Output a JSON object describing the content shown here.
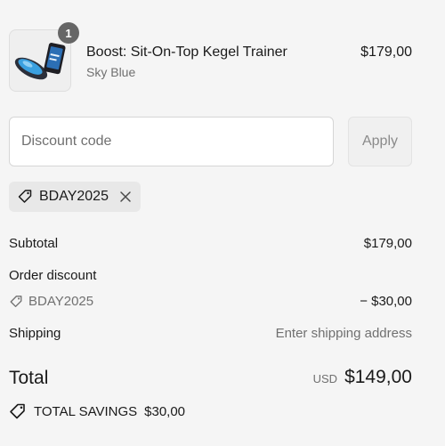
{
  "product": {
    "quantity": "1",
    "name": "Boost: Sit-On-Top Kegel Trainer",
    "variant": "Sky Blue",
    "price": "$179,00",
    "image_icon": "kegel-trainer-with-phone-icon"
  },
  "discount": {
    "placeholder": "Discount code",
    "apply_label": "Apply",
    "applied_code": "BDAY2025"
  },
  "summary": {
    "subtotal_label": "Subtotal",
    "subtotal_value": "$179,00",
    "order_discount_label": "Order discount",
    "discount_code": "BDAY2025",
    "discount_value": "− $30,00",
    "shipping_label": "Shipping",
    "shipping_value": "Enter shipping address",
    "total_label": "Total",
    "currency": "USD",
    "total_value": "$149,00",
    "savings_label": "TOTAL SAVINGS",
    "savings_value": "$30,00"
  },
  "colors": {
    "background": "#f5f5f5",
    "text": "#1a1a1a",
    "muted_text": "#707070",
    "product_accent": "#3aa0e0"
  }
}
